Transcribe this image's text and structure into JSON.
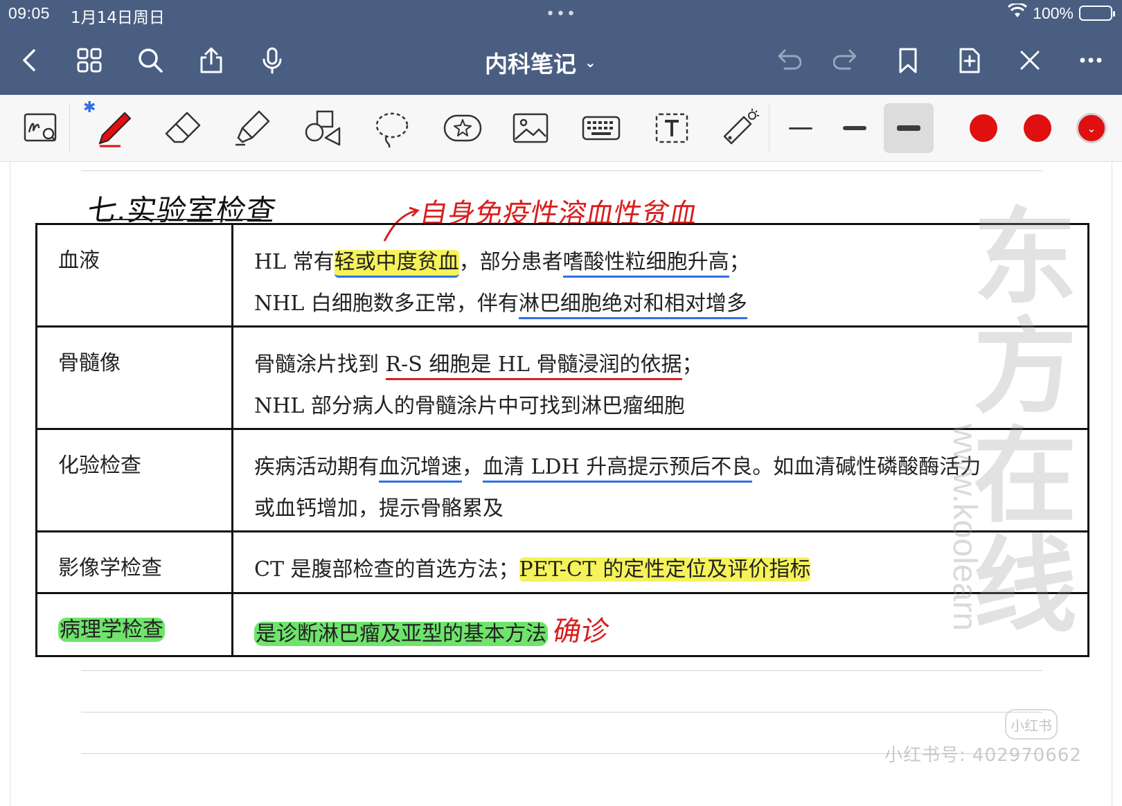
{
  "status_bar": {
    "time": "09:05",
    "date": "1月14日周日",
    "dots": "•••",
    "battery": "100%"
  },
  "nav": {
    "title": "内科笔记",
    "left_icons": [
      "back-icon",
      "grid-icon",
      "search-icon",
      "share-icon",
      "microphone-icon"
    ],
    "right_icons": [
      "undo-icon",
      "redo-icon",
      "bookmark-icon",
      "add-page-icon",
      "close-tools-icon",
      "more-icon"
    ]
  },
  "toolbar": {
    "tools": [
      "handwriting-zoom-icon",
      "pen-icon",
      "eraser-icon",
      "highlighter-icon",
      "shapes-icon",
      "lasso-icon",
      "sticker-icon",
      "image-icon",
      "keyboard-icon",
      "text-box-icon",
      "laser-pointer-icon"
    ],
    "bluetooth": "✱",
    "colors": [
      "#e01010",
      "#e01010",
      "#e01010"
    ]
  },
  "note": {
    "section_title": "七.实验室检查",
    "red_annotation": "自身免疫性溶血性贫血",
    "rows": [
      {
        "category": "血液",
        "line1": {
          "a": "HL 常有",
          "b": "轻或中度贫血",
          "c": "，部分患者",
          "d": "嗜酸性粒细胞升高",
          "e": "；"
        },
        "line2": {
          "a": "NHL 白细胞数多正常，伴有",
          "b": "淋巴细胞绝对和相对增多"
        }
      },
      {
        "category": "骨髓像",
        "line1": {
          "a": "骨髓涂片找到 ",
          "b": "R-S 细胞是 HL 骨髓浸润的依据",
          "c": "；"
        },
        "line2": {
          "a": "NHL 部分病人的骨髓涂片中可找到淋巴瘤细胞"
        }
      },
      {
        "category": "化验检查",
        "line1": {
          "a": "疾病活动期有",
          "b": "血沉增速",
          "c": "，",
          "d": "血清 LDH 升高提示预后不良",
          "e": "。如血清碱性磷酸酶活力"
        },
        "line2": {
          "a": "或血钙增加，提示骨骼累及"
        }
      },
      {
        "category": "影像学检查",
        "line1": {
          "a": "CT 是腹部检查的首选方法；",
          "b": "PET-CT 的定性定位及评价指标"
        }
      },
      {
        "category": "病理学检查",
        "line1": {
          "a": "是诊断淋巴瘤及亚型的基本方法",
          "b": "确诊"
        }
      }
    ],
    "watermark": {
      "text": "东方在线",
      "url": "www.koolearn",
      "badge": "小红书",
      "id": "小红书号: 402970662"
    }
  }
}
